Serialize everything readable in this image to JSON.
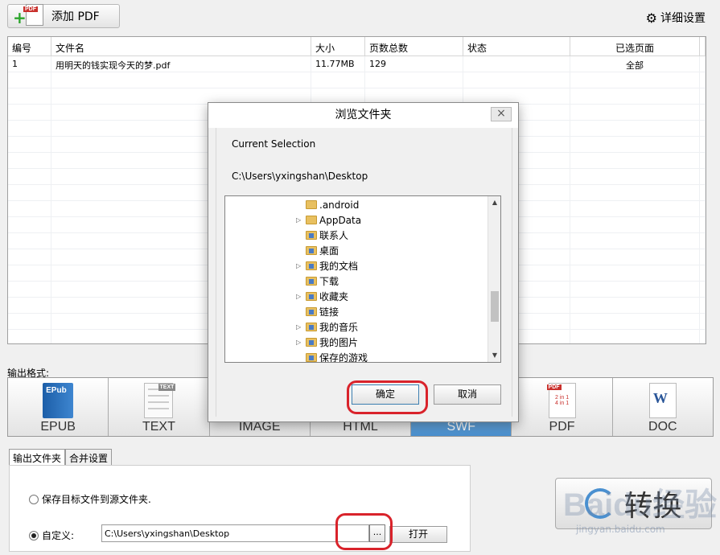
{
  "toolbar": {
    "add_pdf_label": "添加 PDF",
    "add_pdf_badge": "PDF",
    "settings_label": "详细设置"
  },
  "table": {
    "headers": [
      "编号",
      "文件名",
      "大小",
      "页数总数",
      "状态",
      "已选页面"
    ],
    "rows": [
      [
        "1",
        "用明天的钱实现今天的梦.pdf",
        "11.77MB",
        "129",
        "",
        "全部"
      ]
    ]
  },
  "output": {
    "label": "输出格式:",
    "formats": [
      {
        "name": "EPUB",
        "icon": "epub-icon"
      },
      {
        "name": "TEXT",
        "icon": "text-icon"
      },
      {
        "name": "IMAGE",
        "icon": "image-icon"
      },
      {
        "name": "HTML",
        "icon": "html-icon"
      },
      {
        "name": "SWF",
        "icon": "swf-icon"
      },
      {
        "name": "PDF",
        "icon": "pdf-icon"
      },
      {
        "name": "DOC",
        "icon": "doc-icon"
      }
    ],
    "selected": "SWF",
    "epub_icon_text": "EPub",
    "text_icon_text": "TEXT",
    "pdf_icon_badge": "PDF",
    "pdf_icon_line1": "2 in 1",
    "pdf_icon_line2": "4 in 1",
    "doc_icon_text": "W"
  },
  "bottom": {
    "tabs": [
      "输出文件夹",
      "合并设置"
    ],
    "radio_source": "保存目标文件到源文件夹.",
    "radio_custom": "自定义:",
    "path_value": "C:\\Users\\yxingshan\\Desktop",
    "browse_label": "...",
    "open_label": "打开",
    "convert_label": "转换"
  },
  "watermark": {
    "text": "Baidu经验",
    "sub": "jingyan.baidu.com"
  },
  "dialog": {
    "title": "浏览文件夹",
    "close_label": "×",
    "current_selection_label": "Current Selection",
    "current_path": "C:\\Users\\yxingshan\\Desktop",
    "items": [
      {
        "name": ".android",
        "expandable": false
      },
      {
        "name": "AppData",
        "expandable": true
      },
      {
        "name": "联系人",
        "expandable": false
      },
      {
        "name": "桌面",
        "expandable": false
      },
      {
        "name": "我的文档",
        "expandable": true
      },
      {
        "name": "下载",
        "expandable": false
      },
      {
        "name": "收藏夹",
        "expandable": true
      },
      {
        "name": "链接",
        "expandable": false
      },
      {
        "name": "我的音乐",
        "expandable": true
      },
      {
        "name": "我的图片",
        "expandable": true
      },
      {
        "name": "保存的游戏",
        "expandable": false
      }
    ],
    "ok_label": "确定",
    "cancel_label": "取消"
  }
}
